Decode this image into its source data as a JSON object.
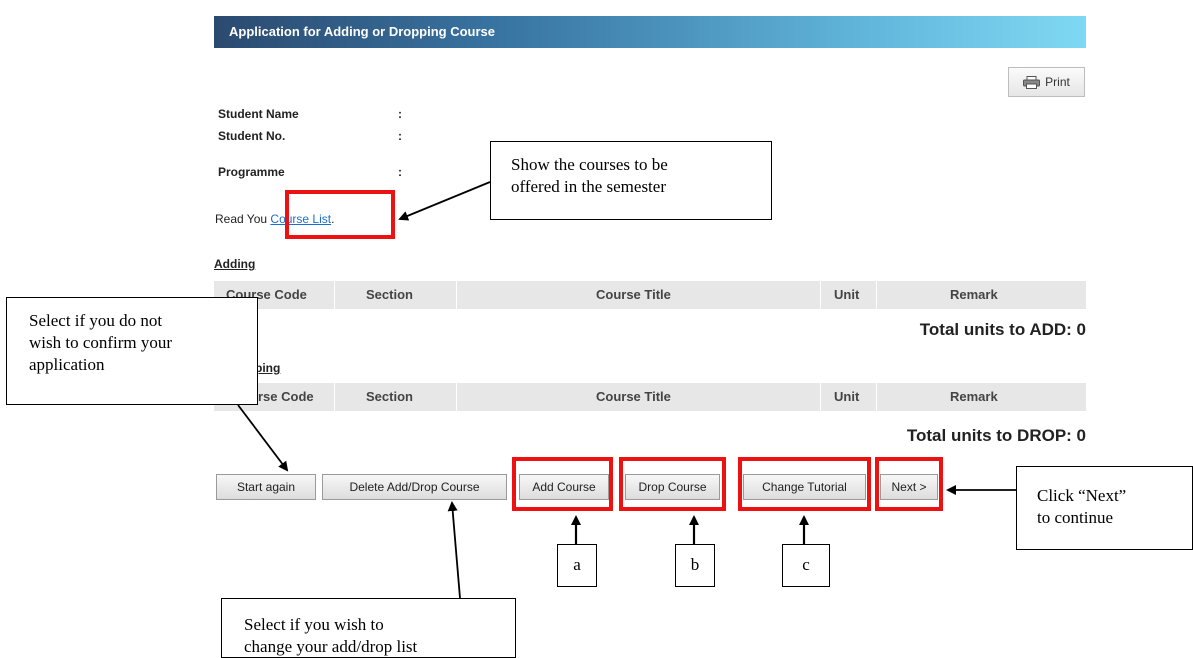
{
  "header": {
    "title": "Application for Adding or Dropping Course"
  },
  "toolbar": {
    "print_label": "Print",
    "print_icon": "printer-icon"
  },
  "student": {
    "name_label": "Student Name",
    "number_label": "Student No.",
    "programme_label": "Programme",
    "colon": ":"
  },
  "read_line": {
    "prefix": "Read You",
    "link": "Course List",
    "suffix": "."
  },
  "adding": {
    "title": "Adding",
    "columns": [
      "Course Code",
      "Section",
      "Course Title",
      "Unit",
      "Remark"
    ],
    "total": "Total units to ADD: 0"
  },
  "dropping": {
    "title": "ping",
    "columns": [
      "rse Code",
      "Section",
      "Course Title",
      "Unit",
      "Remark"
    ],
    "total": "Total units to DROP: 0"
  },
  "buttons": {
    "start_again": "Start again",
    "delete_add_drop": "Delete Add/Drop Course",
    "add_course": "Add Course",
    "drop_course": "Drop Course",
    "change_tutorial": "Change Tutorial",
    "next": "Next >"
  },
  "annotations": {
    "course_list_callout": [
      "Show the courses to be",
      "offered in the semester"
    ],
    "start_again_callout": [
      "Select if you do not",
      "wish to confirm your",
      "application"
    ],
    "delete_callout": [
      "Select if you wish to",
      "change your add/drop list"
    ],
    "next_callout": [
      "Click “Next”",
      "to continue"
    ],
    "tags": [
      "a",
      "b",
      "c"
    ],
    "highlight_color": "#ee1111"
  }
}
